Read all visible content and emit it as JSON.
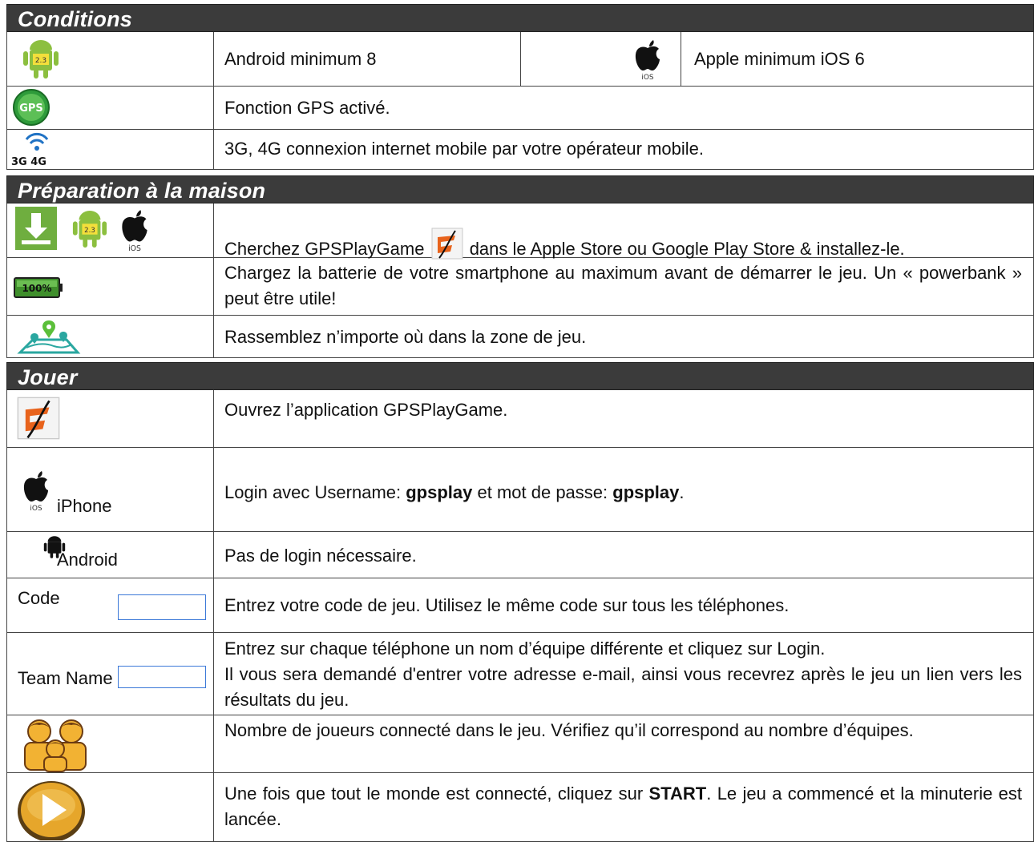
{
  "sections": {
    "conditions": "Conditions",
    "preparation": "Préparation à la maison",
    "jouer": "Jouer"
  },
  "conditions": {
    "android_min": "Android minimum 8",
    "android_badge": "2.3",
    "apple_min": "Apple minimum iOS 6",
    "ios_tag": "iOS",
    "gps_badge": "GPS",
    "gps_text": "Fonction GPS activé.",
    "network_badge": "3G 4G",
    "network_text": "3G, 4G connexion internet mobile par votre opérateur mobile."
  },
  "preparation": {
    "search_before": "Cherchez GPSPlayGame",
    "search_after": "dans le Apple Store ou Google Play Store & installez-le.",
    "battery_badge": "100%",
    "battery_text": "Chargez la batterie de votre smartphone au maximum avant de démarrer le jeu.  Un « powerbank » peut être utile!",
    "gather_text": "Rassemblez n’importe où dans la zone de jeu."
  },
  "jouer": {
    "open_text": "Ouvrez l’application GPSPlayGame.",
    "iphone_label": "iPhone",
    "login_prefix": "Login avec Username: ",
    "login_user": "gpsplay",
    "login_mid": " et mot de passe: ",
    "login_pass": "gpsplay",
    "login_end": ".",
    "android_label": "Android",
    "no_login_text": "Pas de login nécessaire.",
    "code_label": "Code",
    "code_text": "Entrez votre code de jeu.  Utilisez le même code sur tous les téléphones.",
    "team_label": "Team Name",
    "team_line1": "Entrez sur chaque téléphone un nom d’équipe différente et cliquez sur Login.",
    "team_line2": "Il vous sera demandé d'entrer votre adresse e-mail, ainsi vous recevrez après le jeu un lien vers les résultats du jeu.",
    "players_text": "Nombre de joueurs connecté dans le jeu. Vérifiez qu’il correspond au nombre d’équipes.",
    "start_prefix": "Une fois que tout le monde est connecté, cliquez sur ",
    "start_word": "START",
    "start_suffix": ". Le jeu a commencé et la minuterie est lancée."
  },
  "colors": {
    "band": "#3b3b3b",
    "android_green": "#8cbf3f",
    "gps_green": "#2e9b3a",
    "logo_orange": "#e8631c",
    "input_border": "#3b78d8",
    "play_gold": "#e6a62b"
  }
}
